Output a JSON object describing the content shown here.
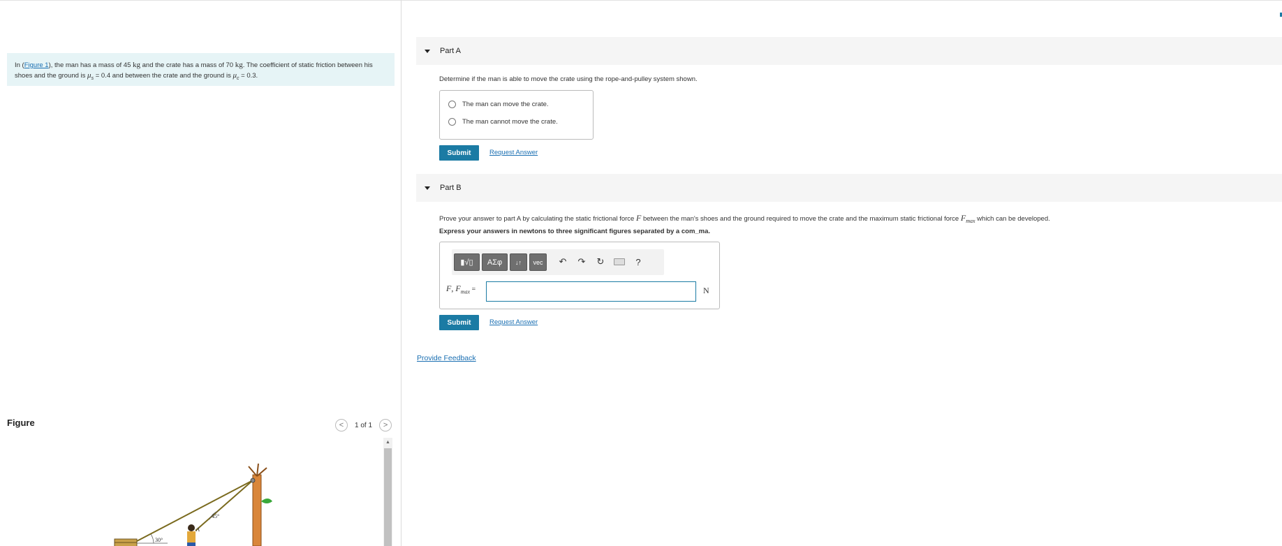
{
  "intro": {
    "before_link": "In (",
    "figure_link": "Figure 1",
    "part1": "), the man has a mass of 45 ",
    "unit_kg_1": "kg",
    "part2": " and the crate has a mass of 70 ",
    "unit_kg_2": "kg",
    "part3": ". The coefficient of static friction between his shoes and the ground is ",
    "mu_s": "μ",
    "mu_s_sub": "s",
    "part4": " = 0.4 and between the crate and the ground is ",
    "mu_c": "μ",
    "mu_c_sub": "c",
    "part5": " = 0.3."
  },
  "figure": {
    "label": "Figure",
    "pager_prev": "<",
    "pager_count": "1 of 1",
    "pager_next": ">",
    "scroll_up": "▲",
    "angle_crate": "30°",
    "angle_rope": "45°",
    "point_label": "A"
  },
  "partA": {
    "title": "Part A",
    "question": "Determine if the man is able to move the crate using the rope-and-pulley system shown.",
    "choices": [
      "The man can move the crate.",
      "The man cannot move the crate."
    ],
    "submit": "Submit",
    "request": "Request Answer"
  },
  "partB": {
    "title": "Part B",
    "q_part1": "Prove your answer to part A by calculating the static frictional force ",
    "q_var_F": "F",
    "q_part2": " between the man's shoes and the ground required to move the crate and the maximum static frictional force ",
    "q_var_Fmax": "F",
    "q_var_Fmax_sub": "max",
    "q_part3": " which can be developed.",
    "instruction": "Express your answers in newtons to three significant figures separated by a com_ma.",
    "toolbar": {
      "templates": "▮√▯",
      "greek": "ΑΣφ",
      "arrows": "↓↑",
      "vec": "vec",
      "undo": "↶",
      "redo": "↷",
      "reset": "↻",
      "help": "?"
    },
    "answer_label_F": "F",
    "answer_label_sep": ", ",
    "answer_label_Fmax": "F",
    "answer_label_Fmax_sub": "max",
    "answer_label_eq": " =",
    "answer_value": "",
    "unit": "N",
    "submit": "Submit",
    "request": "Request Answer"
  },
  "feedback": "Provide Feedback",
  "colors": {
    "accent": "#1b7ba4",
    "link": "#1a6fb2",
    "intro_bg": "#e6f4f6",
    "part_header_bg": "#f5f5f5"
  }
}
